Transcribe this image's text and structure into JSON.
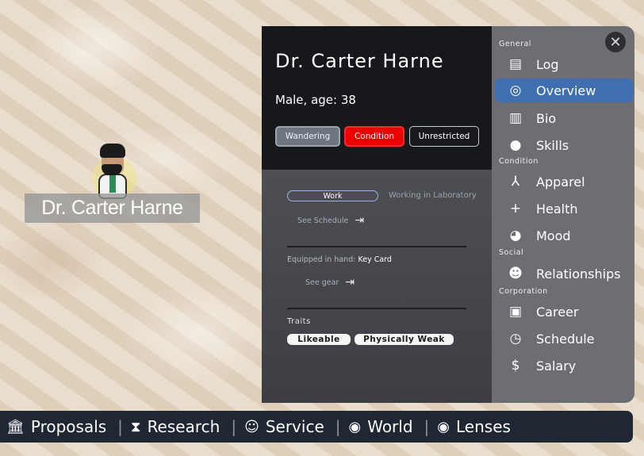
{
  "character_label": "Dr. Carter Harne",
  "panel": {
    "name": "Dr. Carter Harne",
    "info": "Male, age: 38",
    "status_buttons": [
      "Wandering",
      "Condition",
      "Unrestricted"
    ],
    "work_label": "Work",
    "work_status": "Working in Laboratory",
    "see_schedule": "See Schedule",
    "equipped_label": "Equipped in hand:",
    "equipped_item": "Key Card",
    "see_gear": "See gear",
    "traits_label": "Traits",
    "traits": [
      "Likeable",
      "Physically Weak"
    ]
  },
  "sidebar": {
    "sections": {
      "general": "General",
      "condition": "Condition",
      "social": "Social",
      "corporation": "Corporation"
    },
    "items": [
      {
        "label": "Log",
        "icon": "log-icon"
      },
      {
        "label": "Overview",
        "icon": "overview-icon",
        "active": true
      },
      {
        "label": "Bio",
        "icon": "book-icon"
      },
      {
        "label": "Skills",
        "icon": "bulb-icon"
      },
      {
        "label": "Apparel",
        "icon": "hanger-icon"
      },
      {
        "label": "Health",
        "icon": "plus-icon"
      },
      {
        "label": "Mood",
        "icon": "brain-icon"
      },
      {
        "label": "Relationships",
        "icon": "people-icon"
      },
      {
        "label": "Career",
        "icon": "id-badge-icon"
      },
      {
        "label": "Schedule",
        "icon": "clock-icon"
      },
      {
        "label": "Salary",
        "icon": "dollar-icon"
      }
    ]
  },
  "bottom_bar": [
    {
      "label": "Proposals",
      "icon": "bank-icon"
    },
    {
      "label": "Research",
      "icon": "hourglass-icon"
    },
    {
      "label": "Service",
      "icon": "service-icon"
    },
    {
      "label": "World",
      "icon": "globe-icon"
    },
    {
      "label": "Lenses",
      "icon": "eye-icon"
    }
  ],
  "colors": {
    "active_nav": "#3f6fae",
    "condition_button": "#ee0000",
    "bottom_bar": "#1f2733"
  }
}
